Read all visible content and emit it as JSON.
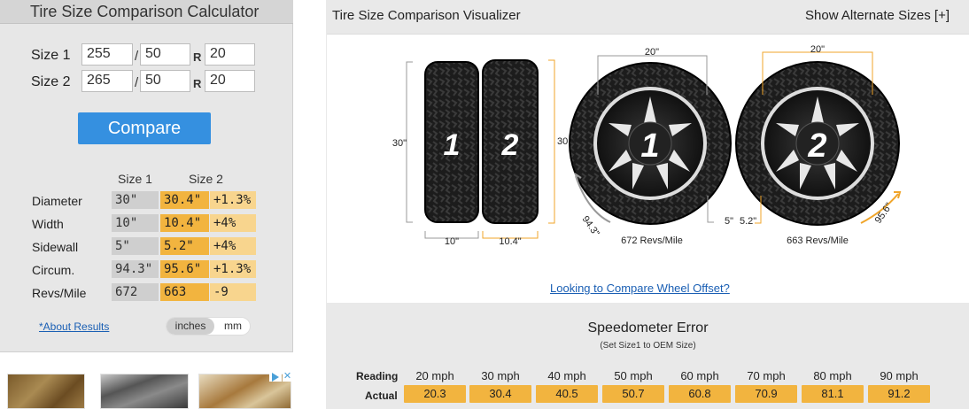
{
  "calculator": {
    "title": "Tire Size Comparison Calculator",
    "size1": {
      "label": "Size 1",
      "width": "255",
      "aspect": "50",
      "rim": "20"
    },
    "size2": {
      "label": "Size 2",
      "width": "265",
      "aspect": "50",
      "rim": "20"
    },
    "sep": "/",
    "rim_letter": "R",
    "compare_label": "Compare",
    "col_size1": "Size 1",
    "col_size2": "Size 2",
    "rows": [
      {
        "label": "Diameter",
        "s1": "30\"",
        "s2": "30.4\"",
        "diff": "+1.3%"
      },
      {
        "label": "Width",
        "s1": "10\"",
        "s2": "10.4\"",
        "diff": "+4%"
      },
      {
        "label": "Sidewall",
        "s1": "5\"",
        "s2": "5.2\"",
        "diff": "+4%"
      },
      {
        "label": "Circum.",
        "s1": "94.3\"",
        "s2": "95.6\"",
        "diff": "+1.3%"
      },
      {
        "label": "Revs/Mile",
        "s1": "672",
        "s2": "663",
        "diff": "-9"
      }
    ],
    "about_link": "*About Results",
    "unit_inches": "inches",
    "unit_mm": "mm"
  },
  "visualizer": {
    "title": "Tire Size Comparison Visualizer",
    "alt_sizes": "Show Alternate Sizes [+]",
    "tire1_number": "1",
    "tire2_number": "2",
    "tire1_diameter": "30\"",
    "tire2_diameter": "30.4\"",
    "tire1_width": "10\"",
    "tire2_width": "10.4\"",
    "wheel1_rim": "20\"",
    "wheel2_rim": "20\"",
    "wheel1_circ": "94.3\"",
    "wheel2_circ": "95.6\"",
    "wheel1_sidewall": "5\"",
    "wheel2_sidewall": "5.2\"",
    "wheel1_revs": "672 Revs/Mile",
    "wheel2_revs": "663 Revs/Mile",
    "offset_link": "Looking to Compare Wheel Offset?"
  },
  "speedometer": {
    "title": "Speedometer Error",
    "subtitle": "(Set Size1 to OEM Size)",
    "reading_label": "Reading",
    "actual_label": "Actual",
    "readings": [
      "20 mph",
      "30 mph",
      "40 mph",
      "50 mph",
      "60 mph",
      "70 mph",
      "80 mph",
      "90 mph"
    ],
    "actuals": [
      "20.3",
      "30.4",
      "40.5",
      "50.7",
      "60.8",
      "70.9",
      "81.1",
      "91.2"
    ]
  },
  "ads": {
    "choices_icon": "adchoices-icon"
  },
  "colors": {
    "accent_blue": "#3590e0",
    "highlight_orange": "#f2b43f",
    "light_orange": "#f8d58e",
    "link_blue": "#1a5fb4"
  }
}
